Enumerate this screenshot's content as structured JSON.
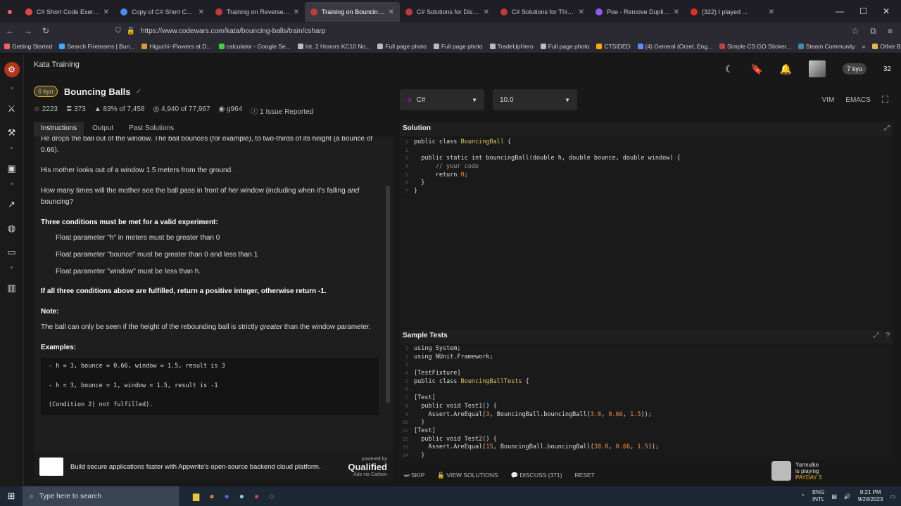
{
  "browser": {
    "tabs": [
      {
        "label": "C# Short Code Exercises",
        "color": "#e54444",
        "active": false
      },
      {
        "label": "Copy of C# Short Code Ex",
        "color": "#4a8af4",
        "active": false
      },
      {
        "label": "Training on Reverse words",
        "color": "#c13a3a",
        "active": false
      },
      {
        "label": "Training on Bouncing Balls",
        "color": "#c13a3a",
        "active": true
      },
      {
        "label": "C# Solutions for Disemvo",
        "color": "#c13a3a",
        "active": false
      },
      {
        "label": "C# Solutions for Thinkful",
        "color": "#c13a3a",
        "active": false
      },
      {
        "label": "Poe - Remove Duplicates",
        "color": "#8b5cf6",
        "active": false
      },
      {
        "label": "(322) I played ...",
        "color": "#e52d27",
        "active": false
      }
    ],
    "url": "https://www.codewars.com/kata/bouncing-balls/train/csharp",
    "bookmarks": [
      "Getting Started",
      "Search Fireteams | Bun...",
      "Higuchi~Flowers at D...",
      "calculator - Google Se...",
      "Int. 2 Honors KC10 No...",
      "Full page photo",
      "Full page photo",
      "TradeUpHero",
      "Full page photo",
      "CTSIDED",
      "(4) General (Orzel, Eng...",
      "Simple CS:GO Sticker...",
      "Steam Community"
    ],
    "other_bookmarks": "Other Bookmarks"
  },
  "header": {
    "breadcrumb": "Kata Training",
    "rank": "7 kyu",
    "honor": "32"
  },
  "kata": {
    "kyu": "6 kyu",
    "title": "Bouncing Balls",
    "stats": {
      "votes": "2223",
      "bookmarks": "373",
      "satisfaction": "83% of 7,458",
      "completed": "4,940 of 77,967",
      "author": "g964",
      "issues": "1 Issue Reported"
    }
  },
  "tabs": {
    "instructions": "Instructions",
    "output": "Output",
    "past": "Past Solutions"
  },
  "instructions": {
    "p0": "He drops the ball out of the window. The ball bounces (for example), to two-thirds of its height (a bounce of 0.66).",
    "p1": "His mother looks out of a window 1.5 meters from the ground.",
    "p2a": "How many times will the mother see the ball pass in front of her window (including when it's falling ",
    "p2b": "and",
    "p2c": " bouncing?",
    "conditions_heading": "Three conditions must be met for a valid experiment:",
    "c1": "Float parameter \"h\" in meters must be greater than 0",
    "c2": "Float parameter \"bounce\" must be greater than 0 and less than 1",
    "c3": "Float parameter \"window\" must be less than h.",
    "fulfilled": "If all three conditions above are fulfilled, return a positive integer, otherwise return -1.",
    "note_heading": "Note:",
    "note_a": "The ball can only be seen if the height of the rebounding ball is strictly ",
    "note_b": "greater",
    "note_c": " than the window parameter.",
    "examples_heading": "Examples:",
    "ex1": "- h = 3, bounce = 0.66, window = 1.5, result is 3",
    "ex2": "- h = 3, bounce = 1, window = 1.5, result is -1",
    "ex3": "(Condition 2) not fulfilled)."
  },
  "ad": {
    "text": "Build secure applications faster with Appwrite's open-source backend cloud platform.",
    "powered": "powered by",
    "brand": "Qualified",
    "via": "Ads via Carbon"
  },
  "editor": {
    "language": "C#",
    "version": "10.0",
    "modes": [
      "VIM",
      "EMACS"
    ],
    "solution_title": "Solution",
    "solution_lines": [
      "public class BouncingBall {",
      "",
      "  public static int bouncingBall(double h, double bounce, double window) {",
      "      // your code",
      "      return 0;",
      "  }",
      "}"
    ],
    "tests_title": "Sample Tests",
    "test_lines": [
      "using System;",
      "using NUnit.Framework;",
      "",
      "[TestFixture]",
      "public class BouncingBallTests {",
      "",
      "[Test]",
      "  public void Test1() {",
      "    Assert.AreEqual(3, BouncingBall.bouncingBall(3.0, 0.66, 1.5));",
      "  }",
      "[Test]",
      "  public void Test2() {",
      "    Assert.AreEqual(15, BouncingBall.bouncingBall(30.0, 0.66, 1.5));",
      "  }"
    ]
  },
  "actions": {
    "skip": "SKIP",
    "view": "VIEW SOLUTIONS",
    "discuss": "DISCUSS (371)",
    "reset": "RESET"
  },
  "notification": {
    "name": "Yarmulke",
    "status": "is playing",
    "game": "PAYDAY 3"
  },
  "taskbar": {
    "search_placeholder": "Type here to search",
    "lang": "ENG",
    "lang2": "INTL",
    "time": "9:21 PM",
    "date": "9/24/2023"
  }
}
